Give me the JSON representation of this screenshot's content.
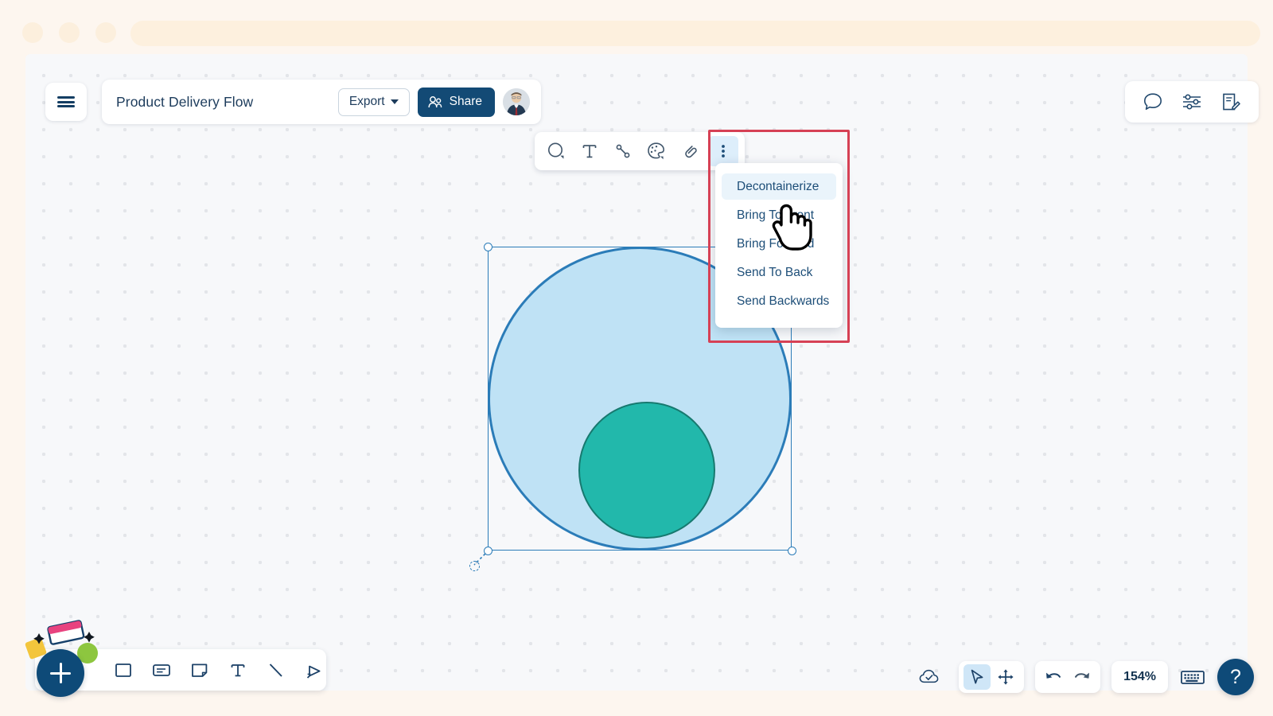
{
  "browser": {
    "traffic_lights": [
      "close",
      "minimize",
      "maximize"
    ],
    "address_bar_value": ""
  },
  "header": {
    "menu_icon": "hamburger-icon",
    "doc_title": "Product Delivery Flow",
    "export_label": "Export",
    "export_caret": "chevron-down-icon",
    "share_label": "Share",
    "share_icon": "people-icon",
    "avatar": "user-avatar"
  },
  "utility_bar": {
    "items": [
      {
        "name": "comment-icon",
        "label": "Comments"
      },
      {
        "name": "settings-sliders-icon",
        "label": "Settings"
      },
      {
        "name": "notes-edit-icon",
        "label": "Notes"
      }
    ]
  },
  "shape_toolbar": {
    "items": [
      {
        "name": "shape-icon",
        "label": "Shape"
      },
      {
        "name": "text-icon",
        "label": "Text"
      },
      {
        "name": "connector-icon",
        "label": "Connector"
      },
      {
        "name": "palette-icon",
        "label": "Color"
      },
      {
        "name": "link-icon",
        "label": "Link"
      },
      {
        "name": "more-options-icon",
        "label": "More"
      }
    ]
  },
  "context_menu": {
    "items": [
      {
        "label": "Decontainerize",
        "hovered": true
      },
      {
        "label": "Bring To Front",
        "hovered": false
      },
      {
        "label": "Bring Forward",
        "hovered": false
      },
      {
        "label": "Send To Back",
        "hovered": false
      },
      {
        "label": "Send Backwards",
        "hovered": false
      }
    ]
  },
  "canvas": {
    "shapes": [
      {
        "name": "outer-circle",
        "type": "circle",
        "fill": "#bfe2f5",
        "stroke": "#2b7cb8",
        "selected": true
      },
      {
        "name": "inner-circle",
        "type": "circle",
        "fill": "#22b8ab",
        "stroke": "#17796f",
        "selected": false
      }
    ],
    "selection_handles": 4,
    "rotation_handle": true
  },
  "bottom_toolbar": {
    "add_label": "+",
    "items": [
      {
        "name": "rectangle-icon",
        "label": "Rectangle"
      },
      {
        "name": "card-icon",
        "label": "Card"
      },
      {
        "name": "sticky-note-icon",
        "label": "Sticky Note"
      },
      {
        "name": "text-icon",
        "label": "Text"
      },
      {
        "name": "line-icon",
        "label": "Line"
      },
      {
        "name": "pen-icon",
        "label": "Pen"
      }
    ]
  },
  "bottom_right": {
    "save_status_icon": "cloud-check-icon",
    "select_tool": "cursor-icon",
    "pan_tool": "move-icon",
    "undo": "undo-icon",
    "redo": "redo-icon",
    "zoom_level": "154%",
    "keyboard_shortcuts_icon": "keyboard-icon",
    "help_label": "?"
  },
  "highlight": {
    "color": "#d64155"
  }
}
